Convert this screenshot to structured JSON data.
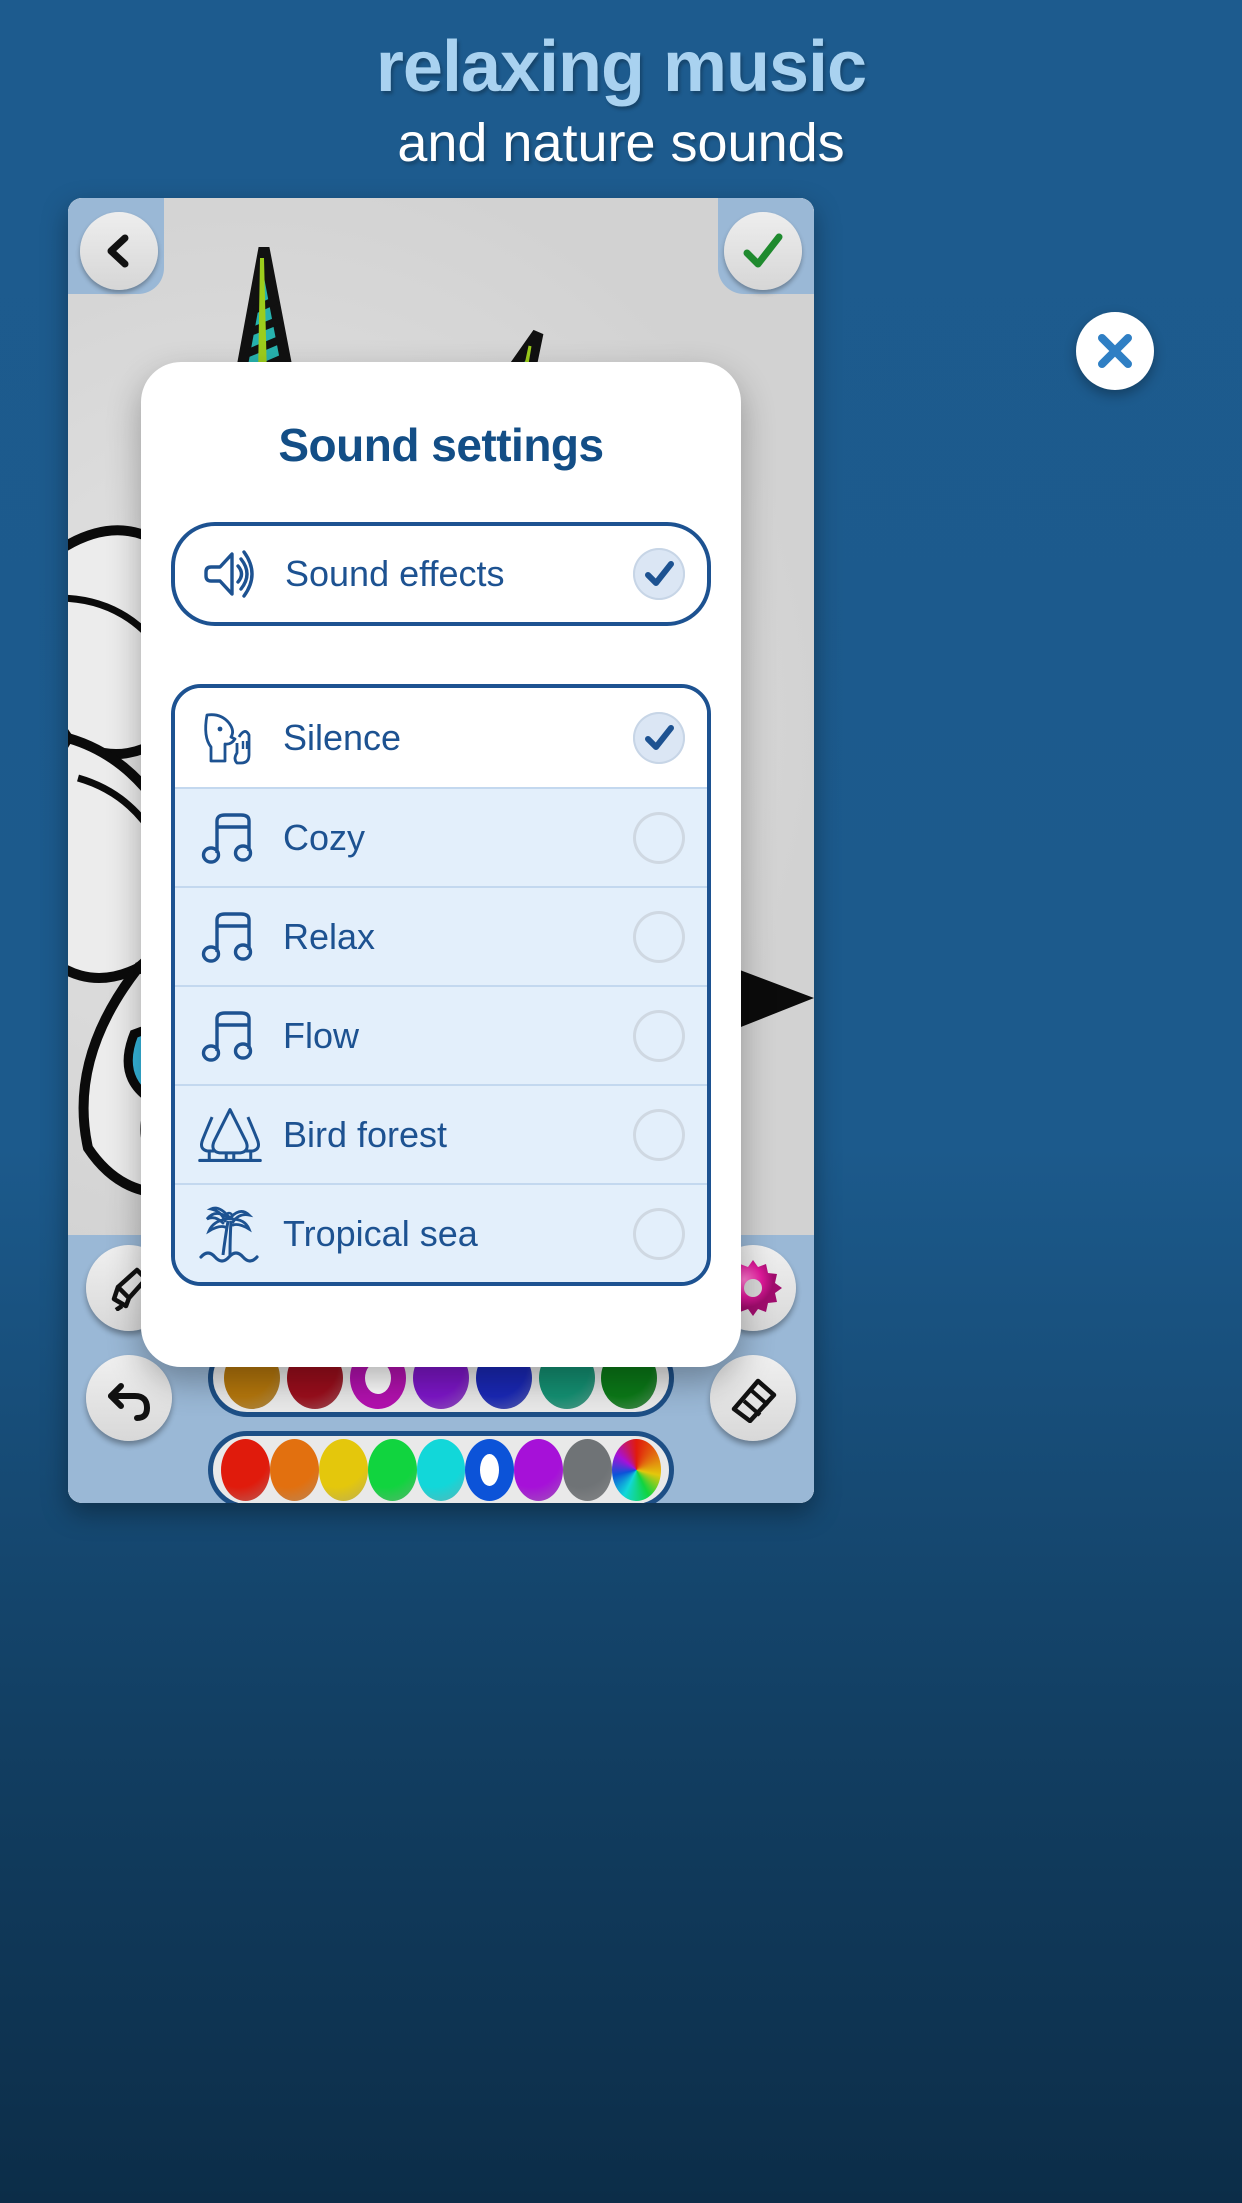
{
  "promo": {
    "title": "relaxing music",
    "subtitle": "and nature sounds",
    "title_color": "#a9d2f0",
    "subtitle_color": "#ffffff",
    "background_color": "#1d5b8e"
  },
  "app_bar": {
    "back_button_icon": "chevron-left-icon",
    "accept_button_icon": "check-icon",
    "accept_color": "#1f8a2e"
  },
  "close_button": {
    "icon": "close-x-icon",
    "color": "#2f7fc4"
  },
  "dialog": {
    "title": "Sound settings",
    "accent_color": "#1d5291",
    "sound_effects": {
      "icon": "speaker-waves-icon",
      "label": "Sound effects",
      "checked": true
    },
    "options": [
      {
        "icon": "shush-face-icon",
        "label": "Silence",
        "selected": true
      },
      {
        "icon": "music-note-icon",
        "label": "Cozy",
        "selected": false
      },
      {
        "icon": "music-note-icon",
        "label": "Relax",
        "selected": false
      },
      {
        "icon": "music-note-icon",
        "label": "Flow",
        "selected": false
      },
      {
        "icon": "forest-trees-icon",
        "label": "Bird forest",
        "selected": false
      },
      {
        "icon": "palm-island-icon",
        "label": "Tropical sea",
        "selected": false
      }
    ]
  },
  "toolbar": {
    "pen_icon": "brush-icon",
    "undo_icon": "undo-arrow-icon",
    "gear_icon": "gear-icon",
    "eraser_icon": "eraser-icon",
    "gear_color": "#e0199b",
    "palette_dark": [
      "#b5770c",
      "#9b0e1c",
      "#b211ae",
      "#7d16c8",
      "#1a28b6",
      "#149173",
      "#0b7a18"
    ],
    "palette_dark_selected_index": 2,
    "palette_bright": [
      "#e01b0c",
      "#e2700f",
      "#e4c70c",
      "#11d43f",
      "#12d7d9",
      "#0c53d8",
      "#a611d8",
      "#6f7376",
      "rainbow"
    ],
    "palette_bright_selected_index": 5
  }
}
